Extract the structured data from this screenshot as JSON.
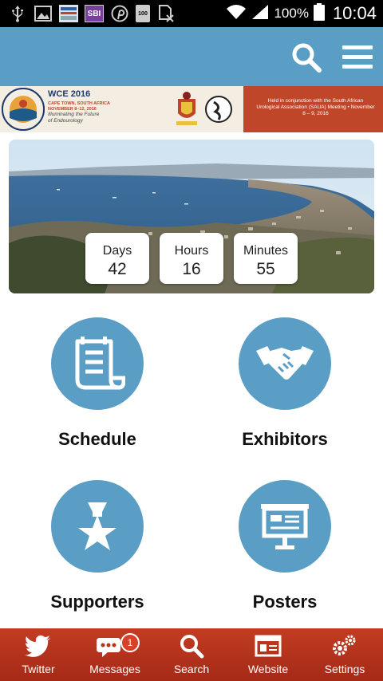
{
  "status_bar": {
    "battery_pct": "100%",
    "time": "10:04",
    "icons": [
      "usb-icon",
      "image-icon",
      "app-thumbnail-icon",
      "sbi-icon",
      "pinterest-icon",
      "battery-100-icon",
      "sim-blocked-icon",
      "wifi-icon",
      "signal-icon",
      "battery-icon"
    ],
    "sbi_label": "SBI",
    "battery_badge": "100"
  },
  "header": {
    "background": "#5a9ec6"
  },
  "banner": {
    "title": "WCE 2016",
    "location_line1": "CAPE TOWN, SOUTH AFRICA",
    "location_line2": "NOVEMBER 8–12, 2016",
    "tagline_line1": "Illuminating the Future",
    "tagline_line2": "of Endourology",
    "note": "Held in conjunction with the South African Urological Association (SAUA) Meeting • November 8 – 9, 2016"
  },
  "countdown": [
    {
      "label": "Days",
      "value": "42"
    },
    {
      "label": "Hours",
      "value": "16"
    },
    {
      "label": "Minutes",
      "value": "55"
    }
  ],
  "menu": [
    {
      "label": "Schedule",
      "icon": "schedule-scroll-icon"
    },
    {
      "label": "Exhibitors",
      "icon": "handshake-icon"
    },
    {
      "label": "Supporters",
      "icon": "star-medal-icon"
    },
    {
      "label": "Posters",
      "icon": "presentation-board-icon"
    }
  ],
  "bottom_nav": [
    {
      "label": "Twitter",
      "icon": "twitter-icon"
    },
    {
      "label": "Messages",
      "icon": "chat-icon",
      "badge": "1"
    },
    {
      "label": "Search",
      "icon": "search-icon"
    },
    {
      "label": "Website",
      "icon": "browser-window-icon"
    },
    {
      "label": "Settings",
      "icon": "gears-icon"
    }
  ],
  "colors": {
    "accent": "#5a9ec6",
    "nav": "#b8351d",
    "banner_red": "#c0462a"
  }
}
